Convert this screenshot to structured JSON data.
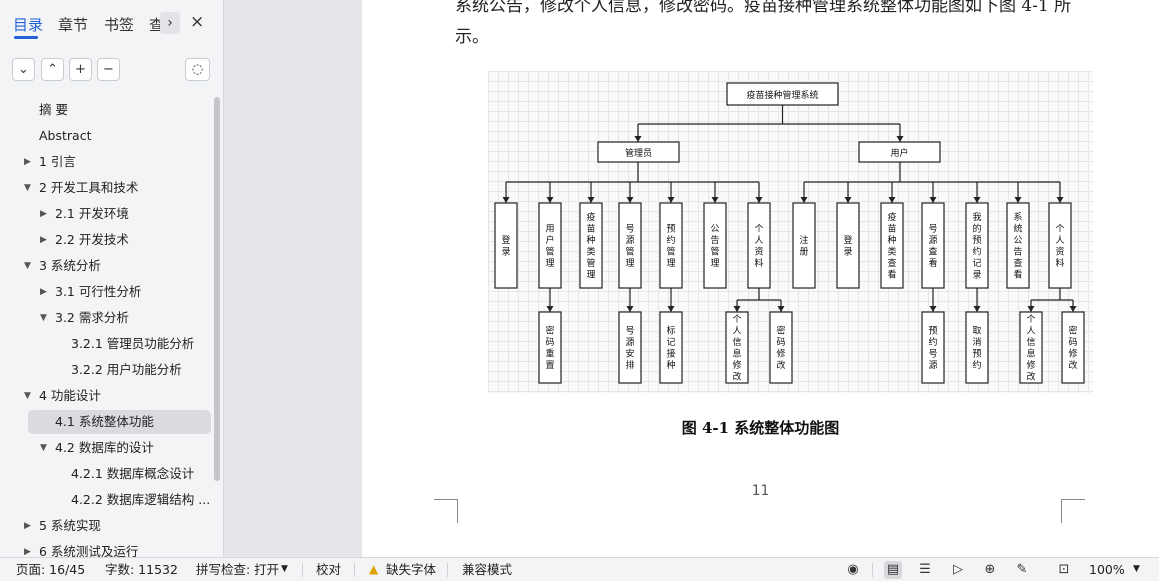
{
  "sidebar": {
    "tabs": [
      "目录",
      "章节",
      "书签",
      "查"
    ],
    "arrow": "›",
    "close": "×",
    "toolbar": {
      "collapse": "⌄",
      "expand": "⌃",
      "add": "+",
      "remove": "−"
    },
    "outline": [
      {
        "label": "摘  要",
        "level": 1,
        "arrow": ""
      },
      {
        "label": "Abstract",
        "level": 1,
        "arrow": ""
      },
      {
        "label": "1 引言",
        "level": 1,
        "arrow": "▶"
      },
      {
        "label": "2 开发工具和技术",
        "level": 1,
        "arrow": "▼"
      },
      {
        "label": "2.1 开发环境",
        "level": 2,
        "arrow": "▶"
      },
      {
        "label": "2.2 开发技术",
        "level": 2,
        "arrow": "▶"
      },
      {
        "label": "3 系统分析",
        "level": 1,
        "arrow": "▼"
      },
      {
        "label": "3.1 可行性分析",
        "level": 2,
        "arrow": "▶"
      },
      {
        "label": "3.2 需求分析",
        "level": 2,
        "arrow": "▼"
      },
      {
        "label": "3.2.1 管理员功能分析",
        "level": 3,
        "arrow": ""
      },
      {
        "label": "3.2.2 用户功能分析",
        "level": 3,
        "arrow": ""
      },
      {
        "label": "4 功能设计",
        "level": 1,
        "arrow": "▼"
      },
      {
        "label": "4.1 系统整体功能",
        "level": 2,
        "arrow": "",
        "selected": true
      },
      {
        "label": "4.2 数据库的设计",
        "level": 2,
        "arrow": "▼"
      },
      {
        "label": "4.2.1 数据库概念设计",
        "level": 3,
        "arrow": ""
      },
      {
        "label": "4.2.2 数据库逻辑结构 ...",
        "level": 3,
        "arrow": ""
      },
      {
        "label": "5 系统实现",
        "level": 1,
        "arrow": "▶"
      },
      {
        "label": "6 系统测试及运行",
        "level": 1,
        "arrow": "▶"
      }
    ]
  },
  "document": {
    "line1": "系统公告，修改个人信息，修改密码。疫苗接种管理系统整体功能图如下图 4-1 所",
    "line2": "示。",
    "caption": "图 4-1  系统整体功能图",
    "page_number": "11",
    "diagram": {
      "root": "疫苗接种管理系统",
      "admin": "管理员",
      "user": "用户",
      "admin_children": [
        "登录",
        "用户管理",
        "疫苗种类管理",
        "号源管理",
        "预约管理",
        "公告管理",
        "个人资料"
      ],
      "admin_sub": {
        "user_mgmt": "密码重置",
        "source_mgmt": "号源安排",
        "appt_mgmt": "标记接种",
        "profile_a": "个人信息修改",
        "profile_b": "密码修改"
      },
      "user_children": [
        "注册",
        "登录",
        "疫苗种类查看",
        "号源查看",
        "我的预约记录",
        "系统公告查看",
        "个人资料"
      ],
      "user_sub": {
        "source_view": "预约号源",
        "my_appt": "取消预约",
        "profile_a": "个人信息修改",
        "profile_b": "密码修改"
      }
    }
  },
  "statusbar": {
    "page": "页面: 16/45",
    "words": "字数: 11532",
    "spellcheck": "拼写检查: 打开",
    "proofread": "校对",
    "missing_font": "缺失字体",
    "compat": "兼容模式",
    "zoom": "100%"
  }
}
